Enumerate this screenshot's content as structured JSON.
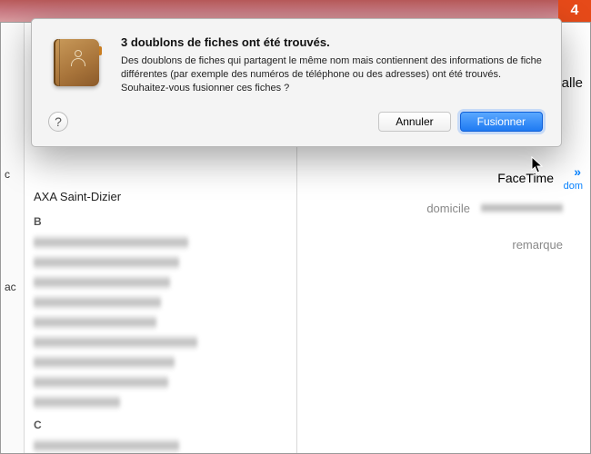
{
  "step_badge": "4",
  "dialog": {
    "title": "3 doublons de fiches ont été trouvés.",
    "message": "Des doublons de fiches qui partagent le même nom mais contiennent des informations de fiche différentes (par exemple des numéros de téléphone ou des adresses) ont été trouvés. Souhaitez-vous fusionner ces fiches ?",
    "cancel_label": "Annuler",
    "confirm_label": "Fusionner",
    "help_label": "?"
  },
  "sidebar": {
    "items": [
      "c",
      "ac"
    ]
  },
  "contacts": {
    "visible_name": "AXA Saint-Dizier",
    "sections": [
      "B",
      "C"
    ]
  },
  "detail": {
    "truncated_text": "alle",
    "facetime_label": "FaceTime",
    "domicile_label": "domicile",
    "remarque_label": "remarque",
    "chevron": "»",
    "dom_cut": "dom"
  }
}
